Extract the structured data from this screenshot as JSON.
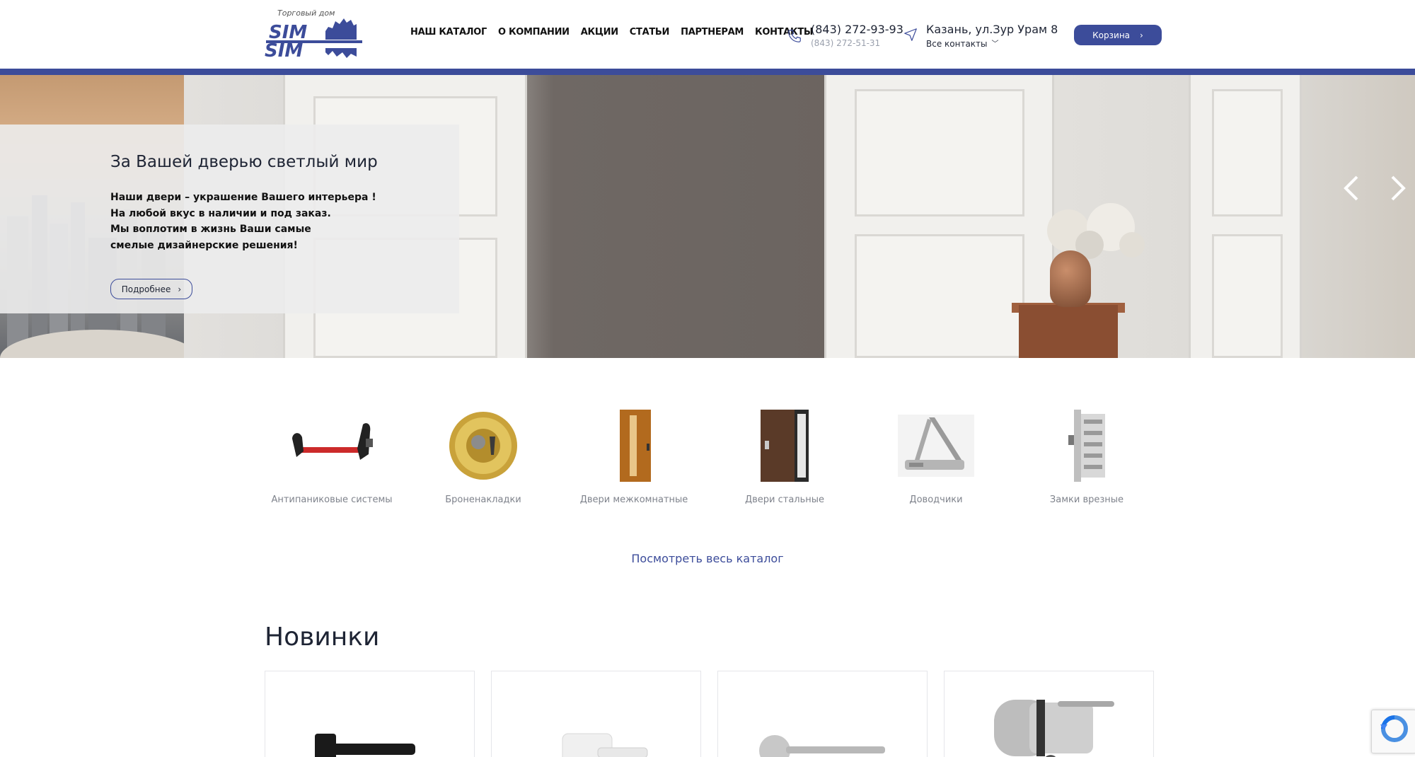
{
  "logo": {
    "tagline": "Торговый дом",
    "line1": "SIM",
    "line2": "SIM"
  },
  "nav": [
    {
      "label": "НАШ КАТАЛОГ"
    },
    {
      "label": "О КОМПАНИИ"
    },
    {
      "label": "АКЦИИ"
    },
    {
      "label": "СТАТЬИ"
    },
    {
      "label": "ПАРТНЕРАМ"
    },
    {
      "label": "КОНТАКТЫ"
    }
  ],
  "contacts": {
    "phone_main": "(843) 272-93-93",
    "phone_alt": "(843) 272-51-31",
    "address": "Казань, ул.Зур Урам 8",
    "all_contacts": "Все контакты"
  },
  "cart": {
    "label": "Корзина"
  },
  "hero": {
    "title": "За Вашей дверью светлый мир",
    "lines": [
      "Наши двери – украшение Вашего интерьера !",
      "На любой вкус в наличии  и под заказ.",
      "Мы воплотим в жизнь Ваши самые",
      "смелые дизайнерские решения!"
    ],
    "button": "Подробнее"
  },
  "categories": [
    {
      "label": "Антипаниковые системы",
      "icon": "panic-bar-icon"
    },
    {
      "label": "Броненакладки",
      "icon": "armor-plate-icon"
    },
    {
      "label": "Двери межкомнатные",
      "icon": "interior-door-icon"
    },
    {
      "label": "Двери стальные",
      "icon": "steel-door-icon"
    },
    {
      "label": "Доводчики",
      "icon": "door-closer-icon"
    },
    {
      "label": "Замки врезные",
      "icon": "mortise-lock-icon"
    }
  ],
  "see_all": "Посмотреть весь каталог",
  "new_section": {
    "title": "Новинки"
  },
  "colors": {
    "accent": "#3c4c9a",
    "text": "#1e2434",
    "muted": "#7f838c"
  }
}
